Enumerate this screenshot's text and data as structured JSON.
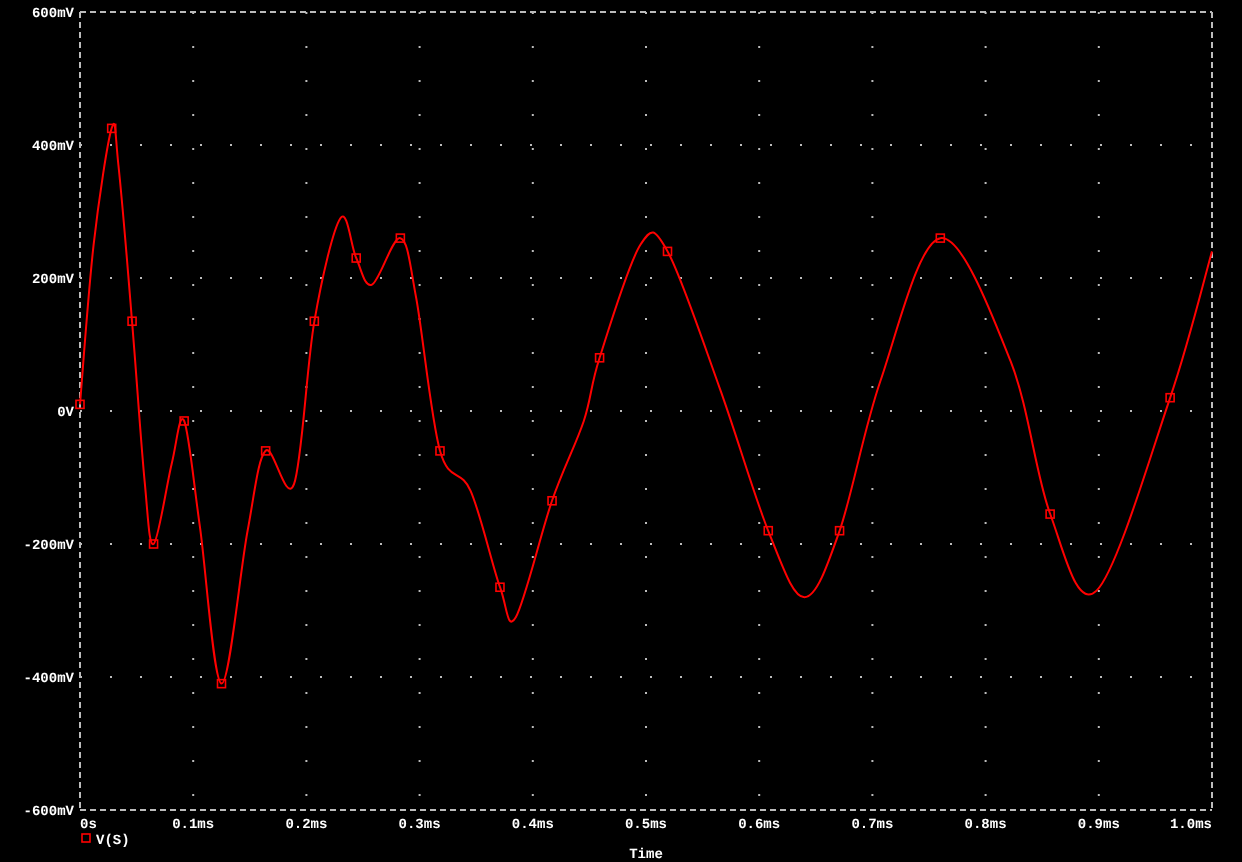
{
  "plot": {
    "chart_data": {
      "type": "line",
      "grid": true,
      "xlabel": "Time",
      "xlim": [
        0,
        1
      ],
      "ylim": [
        -600,
        600
      ],
      "xticks": [
        {
          "value": 0,
          "label": "0s"
        },
        {
          "value": 0.1,
          "label": "0.1ms"
        },
        {
          "value": 0.2,
          "label": "0.2ms"
        },
        {
          "value": 0.3,
          "label": "0.3ms"
        },
        {
          "value": 0.4,
          "label": "0.4ms"
        },
        {
          "value": 0.5,
          "label": "0.5ms"
        },
        {
          "value": 0.6,
          "label": "0.6ms"
        },
        {
          "value": 0.7,
          "label": "0.7ms"
        },
        {
          "value": 0.8,
          "label": "0.8ms"
        },
        {
          "value": 0.9,
          "label": "0.9ms"
        },
        {
          "value": 1,
          "label": "1.0ms"
        }
      ],
      "yticks": [
        {
          "value": 600,
          "label": "600mV"
        },
        {
          "value": 400,
          "label": "400mV"
        },
        {
          "value": 200,
          "label": "200mV"
        },
        {
          "value": 0,
          "label": "0V"
        },
        {
          "value": -200,
          "label": "-200mV"
        },
        {
          "value": -400,
          "label": "-400mV"
        },
        {
          "value": -600,
          "label": "-600mV"
        }
      ],
      "x": [
        0,
        0.012,
        0.028,
        0.034,
        0.046,
        0.057,
        0.065,
        0.081,
        0.092,
        0.106,
        0.125,
        0.148,
        0.164,
        0.189,
        0.207,
        0.23,
        0.244,
        0.258,
        0.283,
        0.297,
        0.318,
        0.345,
        0.371,
        0.385,
        0.417,
        0.445,
        0.459,
        0.495,
        0.519,
        0.565,
        0.608,
        0.64,
        0.671,
        0.707,
        0.76,
        0.822,
        0.857,
        0.898,
        0.963,
        1
      ],
      "series": [
        {
          "name": "V(S)",
          "color": "#ff0000",
          "values": [
            10,
            250,
            425,
            370,
            135,
            -105,
            -200,
            -80,
            -15,
            -175,
            -410,
            -180,
            -60,
            -110,
            135,
            290,
            230,
            190,
            260,
            170,
            -60,
            -120,
            -265,
            -310,
            -135,
            -15,
            80,
            250,
            240,
            35,
            -180,
            -280,
            -180,
            45,
            260,
            75,
            -155,
            -270,
            20,
            240
          ]
        }
      ]
    }
  }
}
